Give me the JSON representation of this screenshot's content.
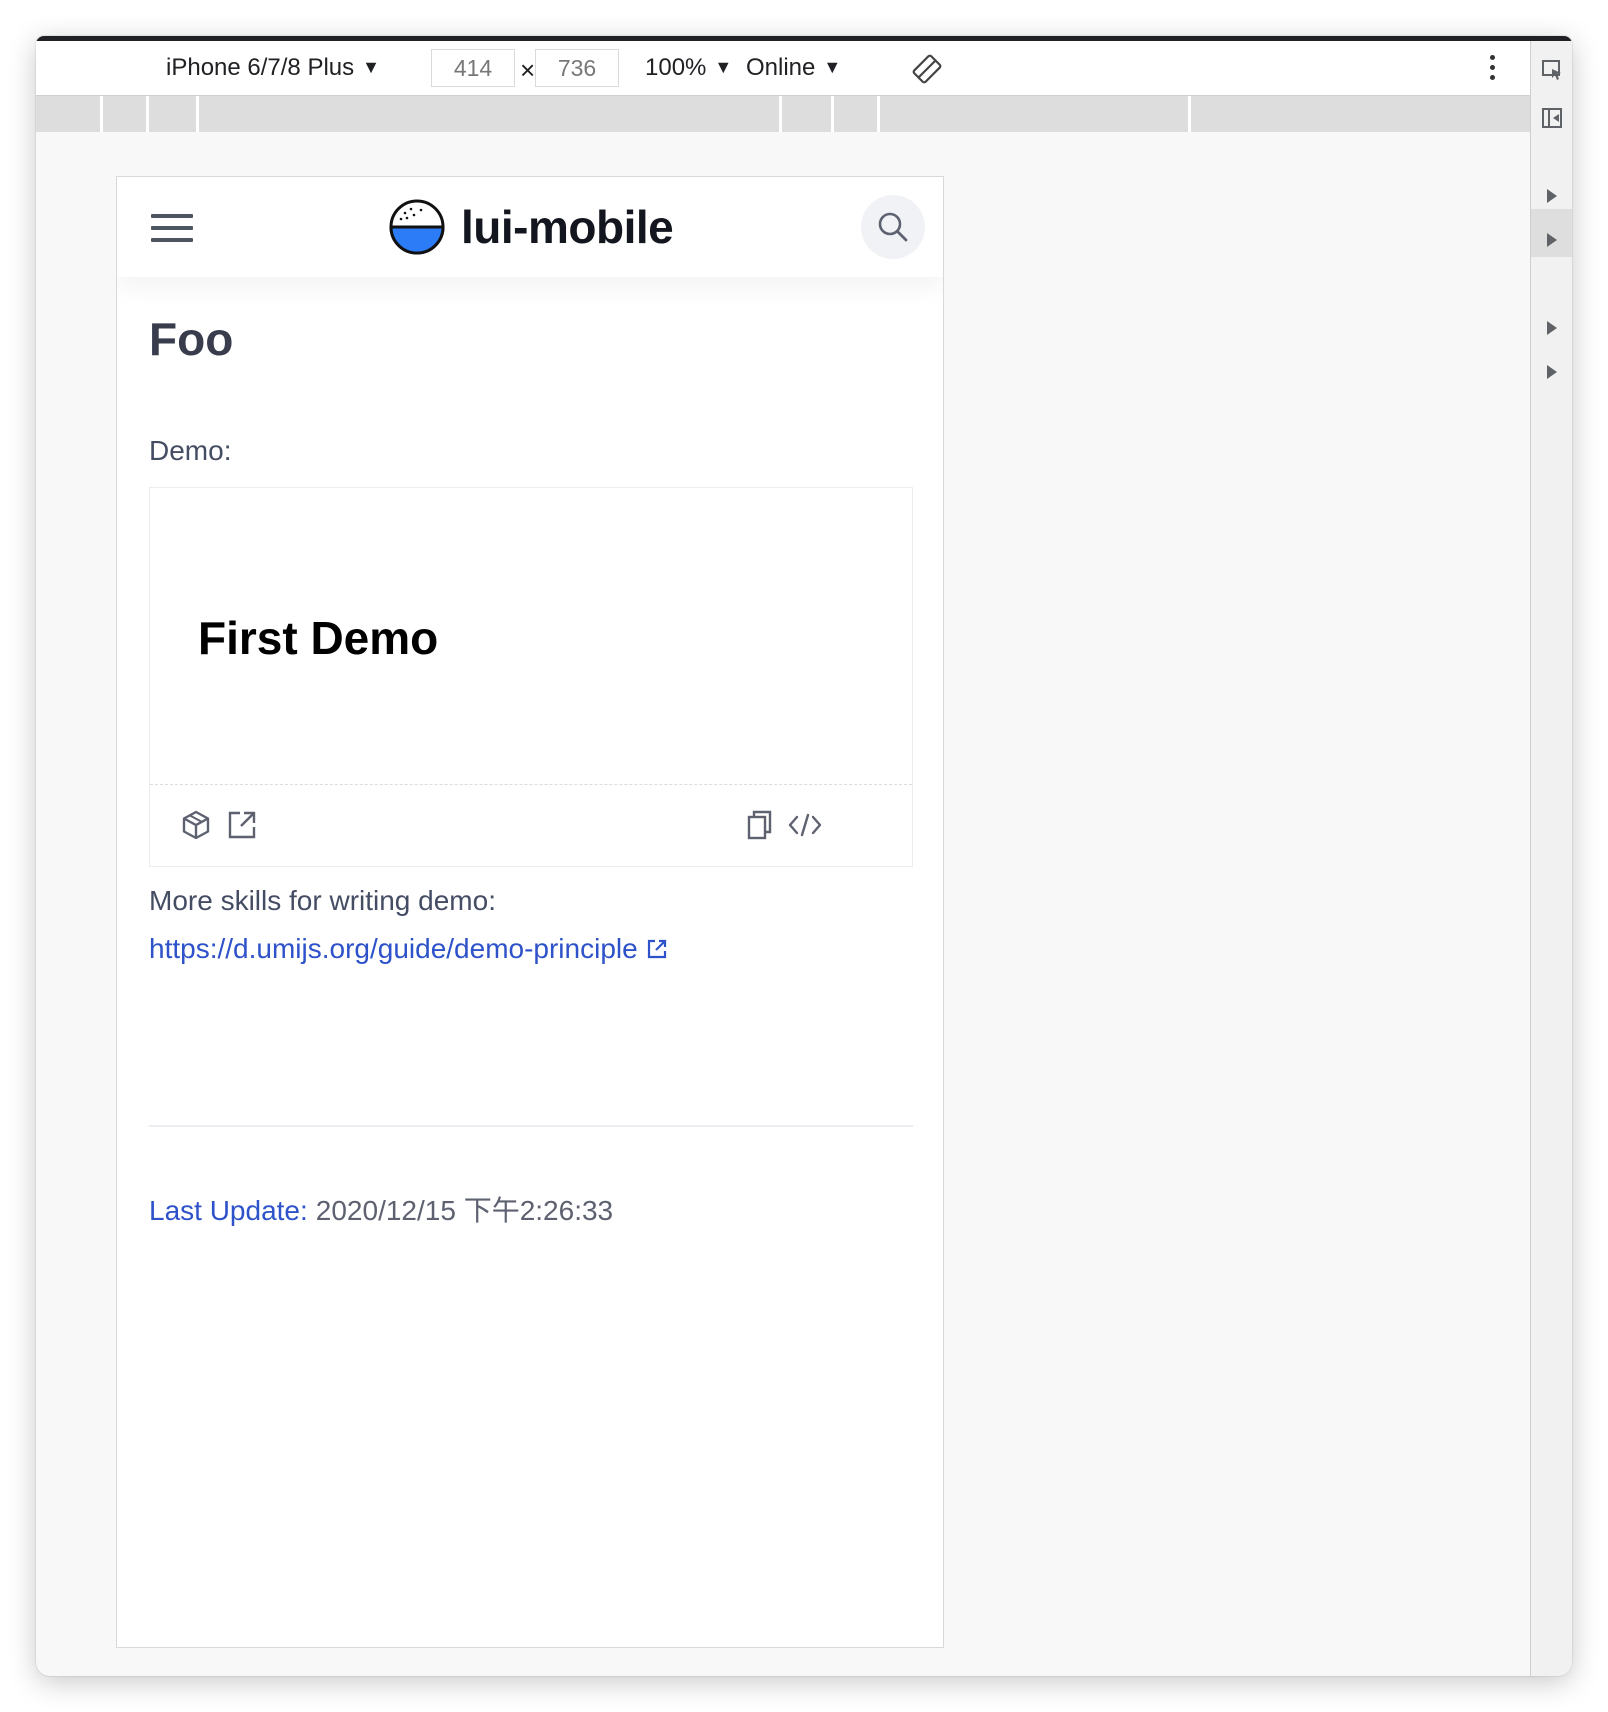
{
  "devtools": {
    "device": "iPhone 6/7/8 Plus",
    "width_value": "414",
    "height_value": "736",
    "times_symbol": "×",
    "zoom": "100%",
    "network": "Online",
    "caret": "▼"
  },
  "site": {
    "brand": "lui-mobile",
    "accent_color": "#2d52c9"
  },
  "page": {
    "title": "Foo",
    "demo_label": "Demo:",
    "demo": {
      "title": "First Demo",
      "actions": [
        "codesandbox-icon",
        "open-external-icon",
        "copy-icon",
        "code-icon"
      ]
    },
    "more_skills_text": "More skills for writing demo:",
    "more_skills_link": "https://d.umijs.org/guide/demo-principle",
    "last_update_label": "Last Update:",
    "last_update_value": "2020/12/15 下午2:26:33"
  }
}
